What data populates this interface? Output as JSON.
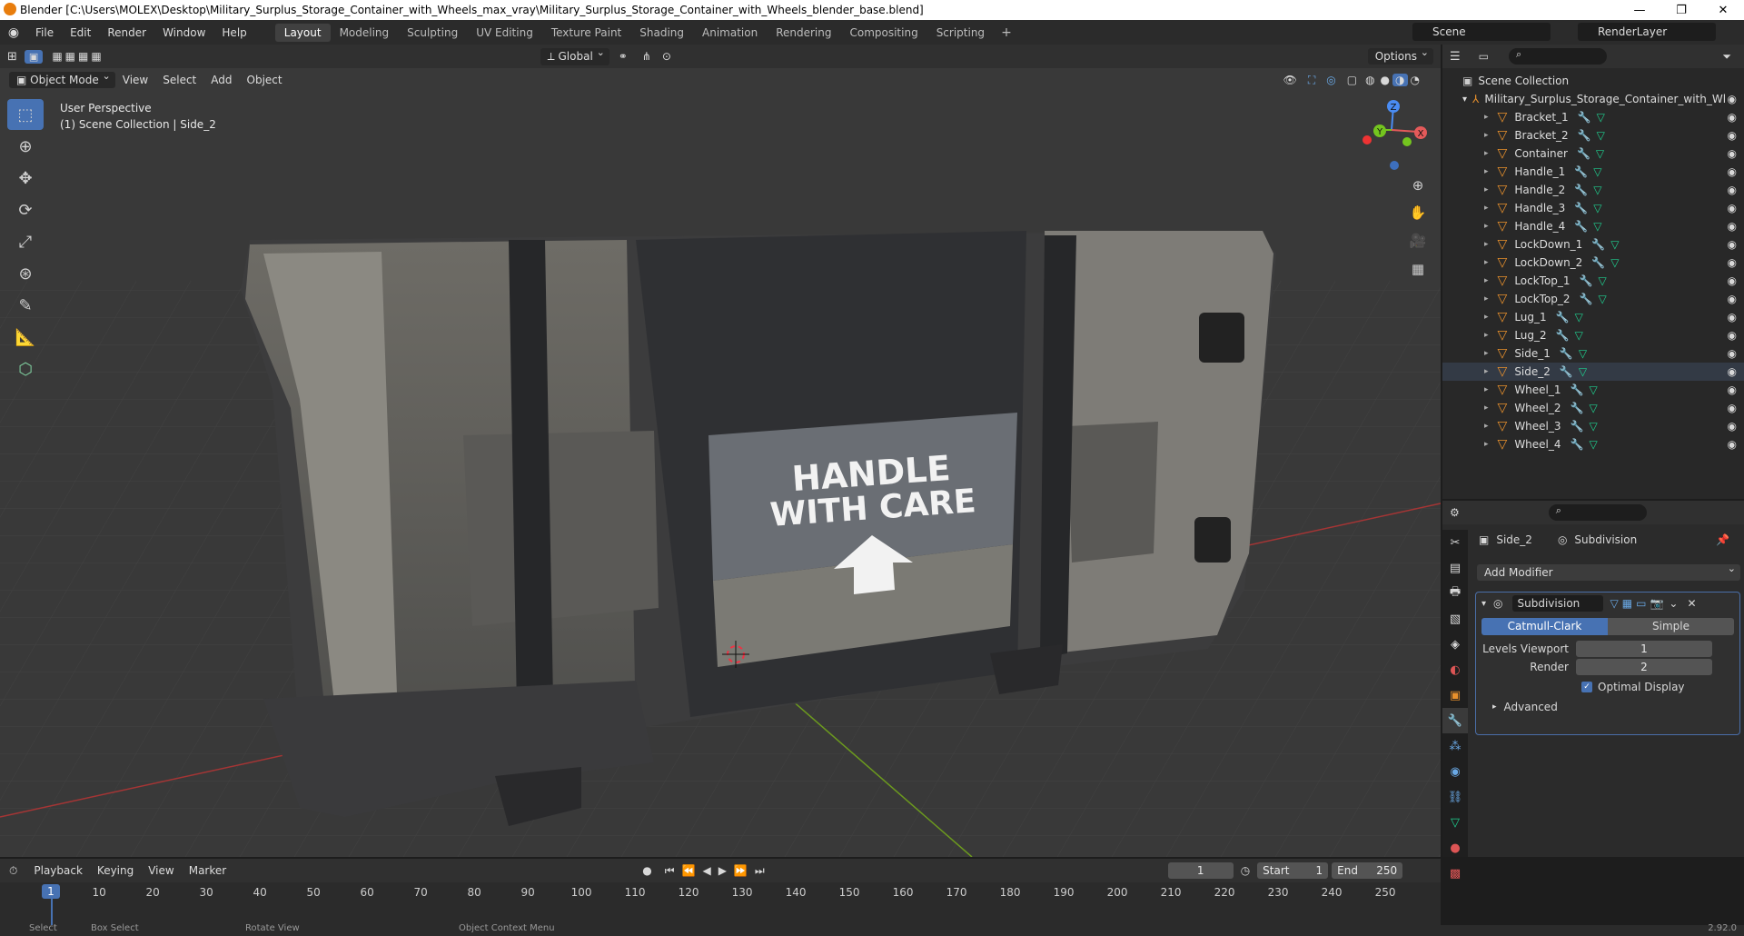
{
  "window": {
    "title": "Blender [C:\\Users\\MOLEX\\Desktop\\Military_Surplus_Storage_Container_with_Wheels_max_vray\\Military_Surplus_Storage_Container_with_Wheels_blender_base.blend]",
    "minimize": "—",
    "maximize": "❐",
    "close": "✕"
  },
  "menu": [
    "File",
    "Edit",
    "Render",
    "Window",
    "Help"
  ],
  "workspaces": [
    "Layout",
    "Modeling",
    "Sculpting",
    "UV Editing",
    "Texture Paint",
    "Shading",
    "Animation",
    "Rendering",
    "Compositing",
    "Scripting"
  ],
  "active_workspace": "Layout",
  "scene": {
    "label": "Scene",
    "render_layer": "RenderLayer"
  },
  "viewport": {
    "mode": "Object Mode",
    "menus": [
      "View",
      "Select",
      "Add",
      "Object"
    ],
    "transform_orientation": "Global",
    "options": "Options",
    "perspective_label": "User Perspective",
    "collection_label": "(1) Scene Collection | Side_2",
    "crate_text_line1": "HANDLE",
    "crate_text_line2": "WITH CARE",
    "gizmo": {
      "x": "X",
      "y": "Y",
      "z": "Z"
    }
  },
  "outliner": {
    "scene_collection": "Scene Collection",
    "root": "Military_Surplus_Storage_Container_with_Wl",
    "items": [
      "Bracket_1",
      "Bracket_2",
      "Container",
      "Handle_1",
      "Handle_2",
      "Handle_3",
      "Handle_4",
      "LockDown_1",
      "LockDown_2",
      "LockTop_1",
      "LockTop_2",
      "Lug_1",
      "Lug_2",
      "Side_1",
      "Side_2",
      "Wheel_1",
      "Wheel_2",
      "Wheel_3",
      "Wheel_4"
    ],
    "selected": "Side_2"
  },
  "properties": {
    "object_name": "Side_2",
    "modifier_tab": "Subdivision",
    "add_modifier": "Add Modifier",
    "modifier_name": "Subdivision",
    "catmull": "Catmull-Clark",
    "simple": "Simple",
    "levels_viewport_label": "Levels Viewport",
    "levels_viewport": "1",
    "render_label": "Render",
    "render_value": "2",
    "optimal_display": "Optimal Display",
    "advanced": "Advanced"
  },
  "timeline": {
    "menus": [
      "Playback",
      "Keying",
      "View",
      "Marker"
    ],
    "current_frame": "1",
    "start_label": "Start",
    "start": "1",
    "end_label": "End",
    "end": "250",
    "ticks": [
      "10",
      "20",
      "30",
      "40",
      "50",
      "60",
      "70",
      "80",
      "90",
      "100",
      "110",
      "120",
      "130",
      "140",
      "150",
      "160",
      "170",
      "180",
      "190",
      "200",
      "210",
      "220",
      "230",
      "240",
      "250"
    ],
    "playhead": "1"
  },
  "status": {
    "select": "Select",
    "box_select": "Box Select",
    "rotate": "Rotate View",
    "context": "Object Context Menu",
    "version": "2.92.0"
  }
}
